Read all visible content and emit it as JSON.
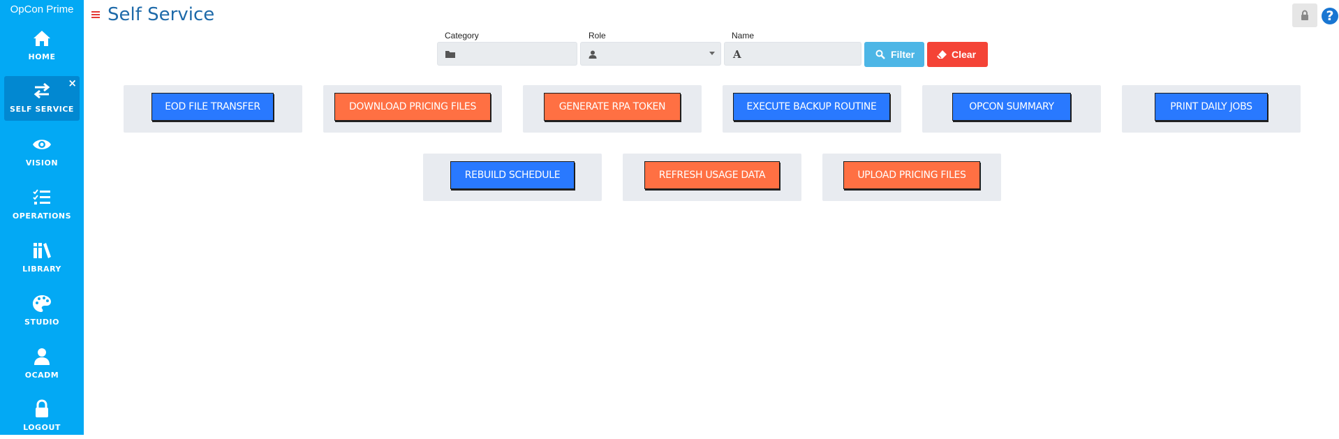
{
  "app": {
    "name": "OpCon Prime",
    "page_title": "Self Service",
    "accent_color": "#03a9f4",
    "title_color": "#1e6aa9"
  },
  "sidebar": {
    "items": [
      {
        "label": "HOME",
        "icon": "home-icon",
        "active": false
      },
      {
        "label": "SELF SERVICE",
        "icon": "arrows-exchange-icon",
        "active": true,
        "close": "×"
      },
      {
        "label": "VISION",
        "icon": "eye-icon",
        "active": false
      },
      {
        "label": "OPERATIONS",
        "icon": "tasks-icon",
        "active": false
      },
      {
        "label": "LIBRARY",
        "icon": "books-icon",
        "active": false
      },
      {
        "label": "STUDIO",
        "icon": "palette-icon",
        "active": false
      },
      {
        "label": "OCADM",
        "icon": "user-icon",
        "active": false
      },
      {
        "label": "LOGOUT",
        "icon": "lock-icon",
        "active": false
      }
    ]
  },
  "header": {
    "menu_icon": "hamburger-icon",
    "lock_icon": "lock-icon",
    "help_label": "?"
  },
  "filters": {
    "category": {
      "label": "Category",
      "value": "",
      "icon": "folder-icon"
    },
    "role": {
      "label": "Role",
      "value": "",
      "icon": "user-icon"
    },
    "name": {
      "label": "Name",
      "value": "",
      "icon": "font-icon"
    },
    "filter_button": {
      "label": "Filter",
      "icon": "search-icon",
      "color": "#4db6e6"
    },
    "clear_button": {
      "label": "Clear",
      "icon": "eraser-icon",
      "color": "#f44336"
    }
  },
  "colors": {
    "blue_action": "#2979ff",
    "orange_action": "#ff7043",
    "tile_bg": "#e8ebf0"
  },
  "actions": [
    {
      "label": "EOD FILE TRANSFER",
      "color": "blue"
    },
    {
      "label": "DOWNLOAD PRICING FILES",
      "color": "orange"
    },
    {
      "label": "GENERATE RPA TOKEN",
      "color": "orange"
    },
    {
      "label": "EXECUTE BACKUP ROUTINE",
      "color": "blue"
    },
    {
      "label": "OPCON SUMMARY",
      "color": "blue"
    },
    {
      "label": "PRINT DAILY JOBS",
      "color": "blue"
    },
    {
      "label": "REBUILD SCHEDULE",
      "color": "blue"
    },
    {
      "label": "REFRESH USAGE DATA",
      "color": "orange"
    },
    {
      "label": "UPLOAD PRICING FILES",
      "color": "orange"
    }
  ]
}
